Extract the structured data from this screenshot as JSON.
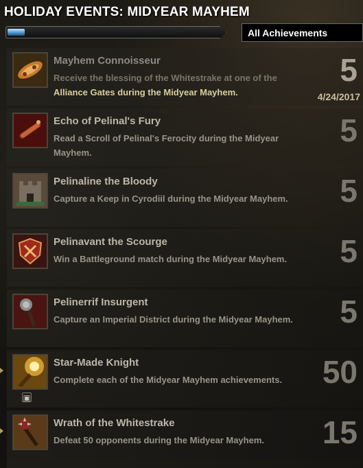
{
  "header": {
    "title": "HOLIDAY EVENTS: MIDYEAR MAYHEM"
  },
  "progress": {
    "fraction": 0.08
  },
  "filter": {
    "selected": "All Achievements"
  },
  "achievements": [
    {
      "title": "Mayhem Connoisseur",
      "desc_plain": "Receive the blessing of the Whitestrake at one of the",
      "desc_highlight": "Alliance Gates during the Midyear Mayhem.",
      "points": "5",
      "date": "4/24/2017",
      "icon": "candied-meat-icon"
    },
    {
      "title": "Echo of Pelinal's Fury",
      "desc": "Read a Scroll of Pelinal's Ferocity during the Midyear Mayhem.",
      "points": "5",
      "icon": "scroll-icon"
    },
    {
      "title": "Pelinaline the Bloody",
      "desc": "Capture a Keep in Cyrodiil during the Midyear Mayhem.",
      "points": "5",
      "icon": "keep-icon"
    },
    {
      "title": "Pelinavant the Scourge",
      "desc": "Win a Battleground match during the Midyear Mayhem.",
      "points": "5",
      "icon": "battleground-shield-icon"
    },
    {
      "title": "Pelinerrif Insurgent",
      "desc": "Capture an Imperial District during the Midyear Mayhem.",
      "points": "5",
      "icon": "mace-icon"
    },
    {
      "title": "Star-Made Knight",
      "desc": "Complete each of the Midyear Mayhem achievements.",
      "points": "50",
      "icon": "radiant-knight-icon",
      "reward_icon": "treasure-chest-icon"
    },
    {
      "title": "Wrath of the Whitestrake",
      "desc": "Defeat 50 opponents during the Midyear Mayhem.",
      "points": "15",
      "icon": "spiked-mace-icon"
    }
  ]
}
